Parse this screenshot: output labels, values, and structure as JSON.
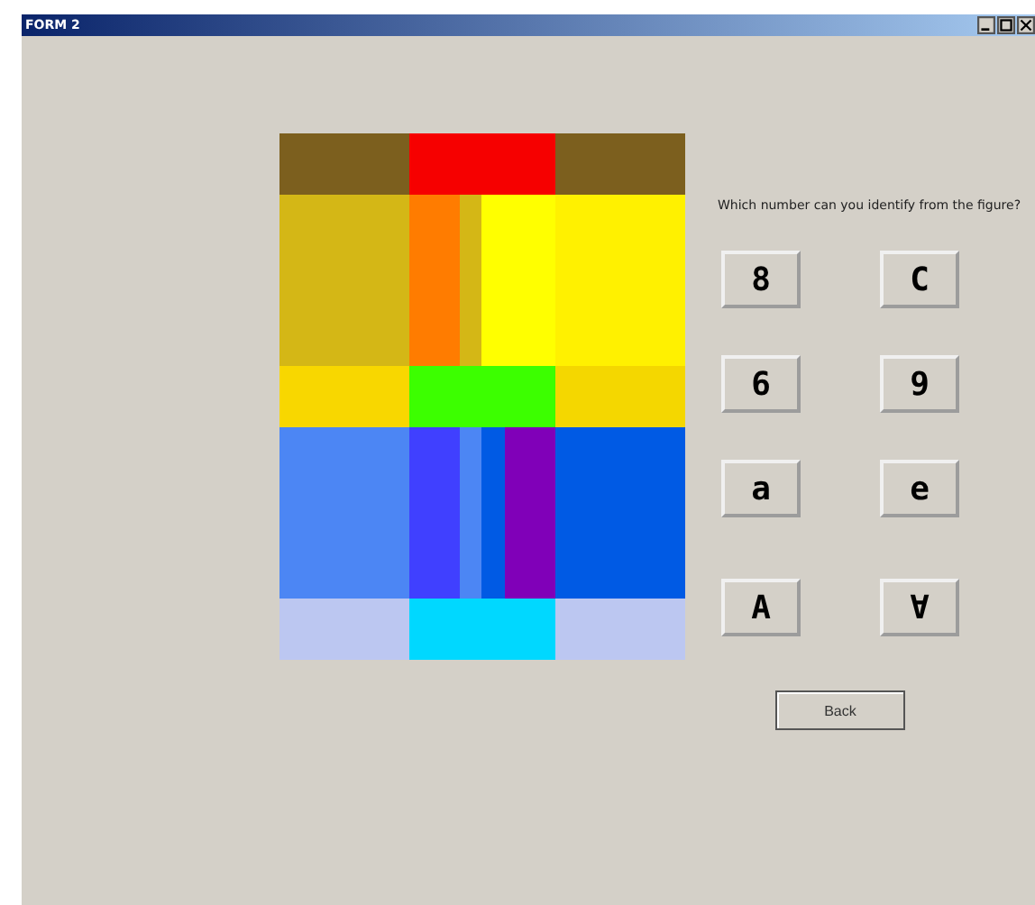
{
  "window": {
    "title": "FORM 2"
  },
  "question": "Which number can you identify from the figure?",
  "answers": [
    {
      "label": "8"
    },
    {
      "label": "C"
    },
    {
      "label": "6"
    },
    {
      "label": "9"
    },
    {
      "label": "a"
    },
    {
      "label": "e"
    },
    {
      "label": "A"
    },
    {
      "label": "∀"
    }
  ],
  "back_button": "Back"
}
